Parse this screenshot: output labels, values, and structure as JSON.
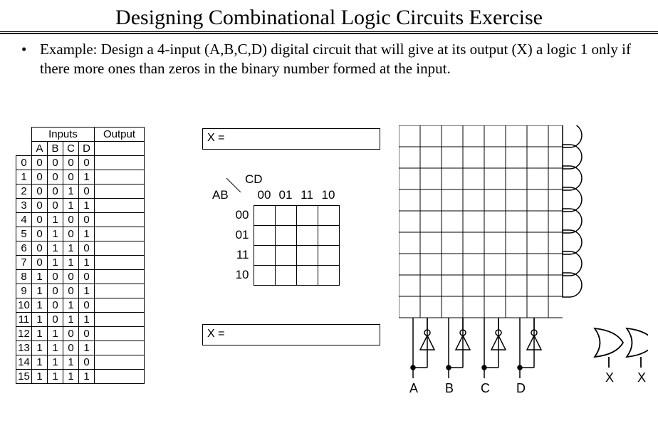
{
  "title": "Designing Combinational Logic Circuits Exercise",
  "bullet": "Example: Design a 4-input (A,B,C,D) digital circuit that will give at its output (X) a logic 1 only if there more ones than zeros in the binary number formed at the input.",
  "truth_table": {
    "header_inputs": "Inputs",
    "header_output": "Output",
    "cols": [
      "A",
      "B",
      "C",
      "D"
    ],
    "rows": [
      {
        "i": "0",
        "v": [
          "0",
          "0",
          "0",
          "0"
        ]
      },
      {
        "i": "1",
        "v": [
          "0",
          "0",
          "0",
          "1"
        ]
      },
      {
        "i": "2",
        "v": [
          "0",
          "0",
          "1",
          "0"
        ]
      },
      {
        "i": "3",
        "v": [
          "0",
          "0",
          "1",
          "1"
        ]
      },
      {
        "i": "4",
        "v": [
          "0",
          "1",
          "0",
          "0"
        ]
      },
      {
        "i": "5",
        "v": [
          "0",
          "1",
          "0",
          "1"
        ]
      },
      {
        "i": "6",
        "v": [
          "0",
          "1",
          "1",
          "0"
        ]
      },
      {
        "i": "7",
        "v": [
          "0",
          "1",
          "1",
          "1"
        ]
      },
      {
        "i": "8",
        "v": [
          "1",
          "0",
          "0",
          "0"
        ]
      },
      {
        "i": "9",
        "v": [
          "1",
          "0",
          "0",
          "1"
        ]
      },
      {
        "i": "10",
        "v": [
          "1",
          "0",
          "1",
          "0"
        ]
      },
      {
        "i": "11",
        "v": [
          "1",
          "0",
          "1",
          "1"
        ]
      },
      {
        "i": "12",
        "v": [
          "1",
          "1",
          "0",
          "0"
        ]
      },
      {
        "i": "13",
        "v": [
          "1",
          "1",
          "0",
          "1"
        ]
      },
      {
        "i": "14",
        "v": [
          "1",
          "1",
          "1",
          "0"
        ]
      },
      {
        "i": "15",
        "v": [
          "1",
          "1",
          "1",
          "1"
        ]
      }
    ]
  },
  "expr1_label": "X =",
  "expr2_label": "X =",
  "kmap": {
    "cd": "CD",
    "ab": "AB",
    "col_headers": [
      "00",
      "01",
      "11",
      "10"
    ],
    "row_headers": [
      "00",
      "01",
      "11",
      "10"
    ]
  },
  "circuit_inputs": [
    "A",
    "B",
    "C",
    "D"
  ],
  "circuit_outputs": [
    "X",
    "X"
  ]
}
